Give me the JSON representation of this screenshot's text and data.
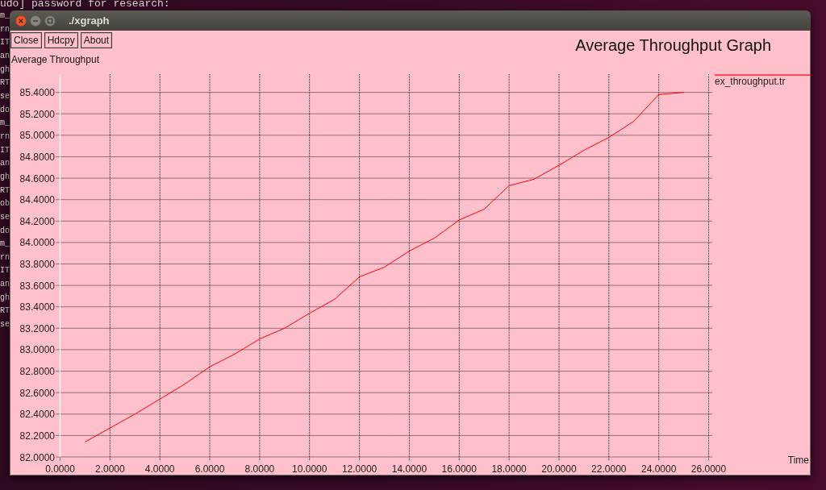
{
  "terminal": {
    "top_line": "udo] password for research:",
    "visible_line_starts": [
      "m_",
      "rn",
      "IT",
      "an",
      "gh",
      "RT",
      "se",
      "do",
      "m_",
      "rn",
      "IT",
      "an",
      "gh",
      "RT",
      "ob",
      "se",
      "do",
      "m_",
      "rn",
      "IT",
      "an",
      "gh",
      "RT",
      "se"
    ]
  },
  "window": {
    "title": "./xgraph"
  },
  "toolbar": {
    "buttons": [
      "Close",
      "Hdcpy",
      "About"
    ]
  },
  "graph": {
    "chart_data": {
      "type": "line",
      "title": "Average Throughput Graph",
      "ylabel": "Average Throughput",
      "x": [
        1,
        2,
        3,
        4,
        5,
        6,
        7,
        8,
        9,
        10,
        11,
        12,
        13,
        14,
        15,
        16,
        17,
        18,
        19,
        20,
        21,
        22,
        23,
        24,
        25
      ],
      "series": [
        {
          "name": "ex_throughput.tr",
          "color": "#ff0000",
          "values": [
            82.14,
            82.27,
            82.4,
            82.54,
            82.68,
            82.84,
            82.96,
            83.1,
            83.2,
            83.34,
            83.47,
            83.68,
            83.77,
            83.92,
            84.04,
            84.21,
            84.31,
            84.53,
            84.59,
            84.72,
            84.86,
            84.98,
            85.13,
            85.38,
            85.4
          ]
        }
      ],
      "xlim": [
        0,
        26
      ],
      "ylim": [
        82,
        85.57
      ],
      "grid": true,
      "xticks": [
        {
          "value": 0,
          "label": "0.0000"
        },
        {
          "value": 2,
          "label": "2.0000"
        },
        {
          "value": 4,
          "label": "4.0000"
        },
        {
          "value": 6,
          "label": "6.0000"
        },
        {
          "value": 8,
          "label": "8.0000"
        },
        {
          "value": 10,
          "label": "10.0000"
        },
        {
          "value": 12,
          "label": "12.0000"
        },
        {
          "value": 14,
          "label": "14.0000"
        },
        {
          "value": 16,
          "label": "16.0000"
        },
        {
          "value": 18,
          "label": "18.0000"
        },
        {
          "value": 20,
          "label": "20.0000"
        },
        {
          "value": 22,
          "label": "22.0000"
        },
        {
          "value": 24,
          "label": "24.0000"
        },
        {
          "value": 26,
          "label": "26.0000"
        }
      ],
      "yticks": [
        {
          "value": 82.0,
          "label": "82.0000"
        },
        {
          "value": 82.2,
          "label": "82.2000"
        },
        {
          "value": 82.4,
          "label": "82.4000"
        },
        {
          "value": 82.6,
          "label": "82.6000"
        },
        {
          "value": 82.8,
          "label": "82.8000"
        },
        {
          "value": 83.0,
          "label": "83.0000"
        },
        {
          "value": 83.2,
          "label": "83.2000"
        },
        {
          "value": 83.4,
          "label": "83.4000"
        },
        {
          "value": 83.6,
          "label": "83.6000"
        },
        {
          "value": 83.8,
          "label": "83.8000"
        },
        {
          "value": 84.0,
          "label": "84.0000"
        },
        {
          "value": 84.2,
          "label": "84.2000"
        },
        {
          "value": 84.4,
          "label": "84.4000"
        },
        {
          "value": 84.6,
          "label": "84.6000"
        },
        {
          "value": 84.8,
          "label": "84.8000"
        },
        {
          "value": 85.0,
          "label": "85.0000"
        },
        {
          "value": 85.2,
          "label": "85.2000"
        },
        {
          "value": 85.4,
          "label": "85.4000"
        }
      ],
      "annotations": [
        {
          "text": "Time"
        }
      ]
    }
  }
}
